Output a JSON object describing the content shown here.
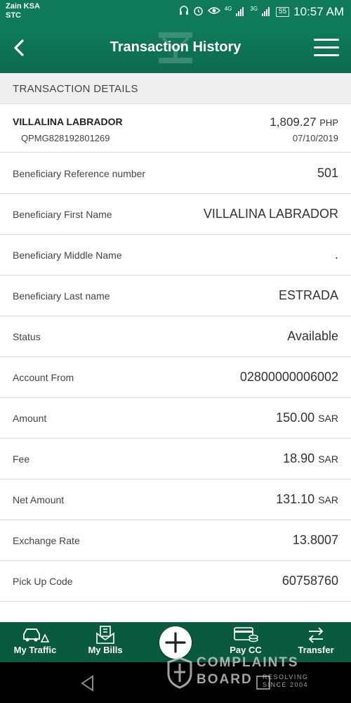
{
  "status_bar": {
    "carrier_1": "Zain KSA",
    "carrier_2": "STC",
    "battery": "55",
    "time": "10:57 AM",
    "network_1": "4G",
    "network_2": "3G"
  },
  "app_bar": {
    "title": "Transaction History",
    "back_icon": "chevron-left-icon",
    "menu_icon": "hamburger-menu-icon"
  },
  "section": {
    "title": "TRANSACTION DETAILS"
  },
  "summary": {
    "name": "VILLALINA LABRADOR",
    "reference": "QPMG828192801269",
    "amount": "1,809.27",
    "currency": "PHP",
    "date": "07/10/2019"
  },
  "details": [
    {
      "label": "Beneficiary Reference number",
      "value": "501",
      "unit": ""
    },
    {
      "label": "Beneficiary First Name",
      "value": "VILLALINA LABRADOR",
      "unit": ""
    },
    {
      "label": "Beneficiary Middle Name",
      "value": ".",
      "unit": ""
    },
    {
      "label": "Beneficiary Last name",
      "value": "ESTRADA",
      "unit": ""
    },
    {
      "label": "Status",
      "value": "Available",
      "unit": ""
    },
    {
      "label": "Account From",
      "value": "02800000006002",
      "unit": ""
    },
    {
      "label": "Amount",
      "value": "150.00",
      "unit": "SAR"
    },
    {
      "label": "Fee",
      "value": "18.90",
      "unit": "SAR"
    },
    {
      "label": "Net Amount",
      "value": "131.10",
      "unit": "SAR"
    },
    {
      "label": "Exchange Rate",
      "value": "13.8007",
      "unit": ""
    },
    {
      "label": "Pick Up Code",
      "value": "60758760",
      "unit": ""
    }
  ],
  "bottom_nav": {
    "items": [
      {
        "label": "My Traffic",
        "icon": "car-warning-icon"
      },
      {
        "label": "My Bills",
        "icon": "bill-envelope-icon"
      },
      {
        "label": "Pay CC",
        "icon": "credit-card-coins-icon"
      },
      {
        "label": "Transfer",
        "icon": "transfer-arrows-icon"
      }
    ],
    "fab_icon": "plus-icon"
  },
  "watermark": {
    "line_1": "COMPLAINTS",
    "line_2": "BOARD",
    "tagline_1": "RESOLVING",
    "tagline_2": "SINCE 2004"
  },
  "colors": {
    "brand_green": "#0e7a57",
    "nav_green": "#0a5a40",
    "header_gray": "#efefef"
  }
}
